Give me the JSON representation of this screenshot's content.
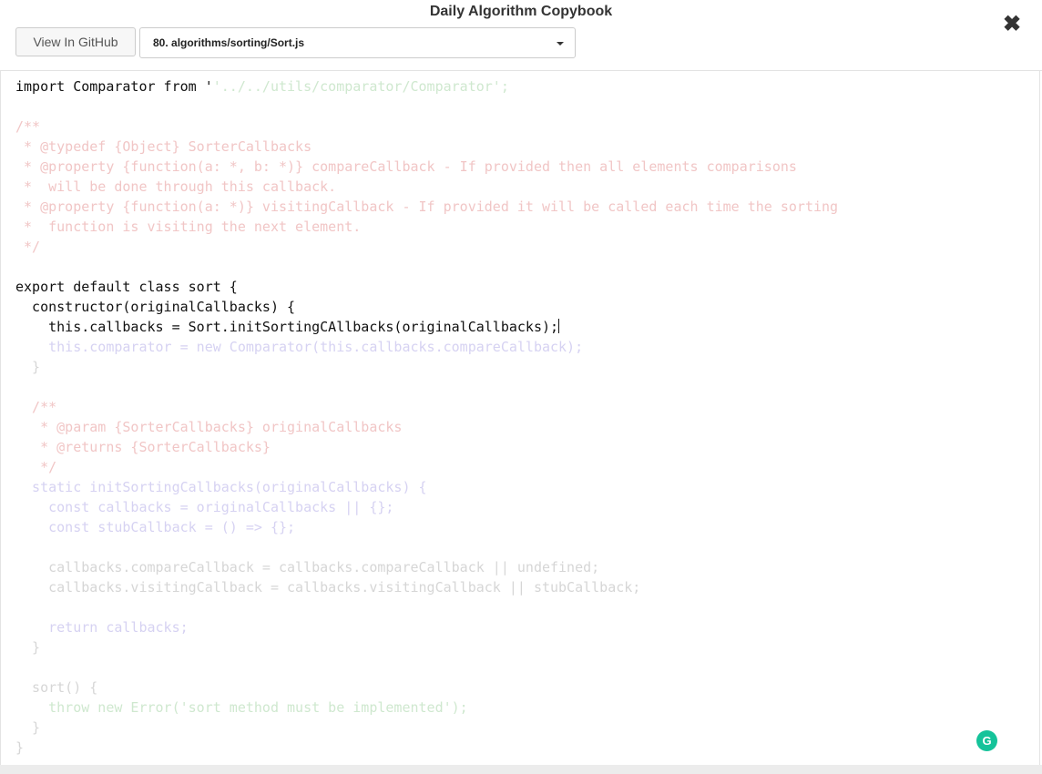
{
  "header": {
    "title": "Daily Algorithm Copybook",
    "close_icon": "✖"
  },
  "toolbar": {
    "github_label": "View In GitHub",
    "file_selected": "80. algorithms/sorting/Sort.js"
  },
  "editor": {
    "lines": [
      {
        "typed": "import Comparator from '",
        "ghost": "'../../utils/comparator/Comparator';",
        "ghost_style": "gs"
      },
      {
        "typed": "",
        "ghost": "",
        "ghost_style": "gf"
      },
      {
        "typed": "",
        "ghost": "/**",
        "ghost_style": "gc"
      },
      {
        "typed": "",
        "ghost": " * @typedef {Object} SorterCallbacks",
        "ghost_style": "gc"
      },
      {
        "typed": "",
        "ghost": " * @property {function(a: *, b: *)} compareCallback - If provided then all elements comparisons",
        "ghost_style": "gc"
      },
      {
        "typed": "",
        "ghost": " *  will be done through this callback.",
        "ghost_style": "gc"
      },
      {
        "typed": "",
        "ghost": " * @property {function(a: *)} visitingCallback - If provided it will be called each time the sorting",
        "ghost_style": "gc"
      },
      {
        "typed": "",
        "ghost": " *  function is visiting the next element.",
        "ghost_style": "gc"
      },
      {
        "typed": "",
        "ghost": " */",
        "ghost_style": "gc"
      },
      {
        "typed": "",
        "ghost": "",
        "ghost_style": "gf"
      },
      {
        "typed": "export default class sort {",
        "ghost": "",
        "ghost_style": "gf"
      },
      {
        "typed": "  constructor(originalCallbacks) {",
        "ghost": "",
        "ghost_style": "gf"
      },
      {
        "typed": "    this.callbacks = Sort.initSortingCAllbacks(originalCallbacks);",
        "ghost": "",
        "ghost_style": "gf",
        "cursor": true
      },
      {
        "typed": "",
        "ghost": "    this.comparator = new Comparator(this.callbacks.compareCallback);",
        "ghost_style": "gk"
      },
      {
        "typed": "",
        "ghost": "  }",
        "ghost_style": "gf"
      },
      {
        "typed": "",
        "ghost": "",
        "ghost_style": "gf"
      },
      {
        "typed": "",
        "ghost": "  /**",
        "ghost_style": "gc"
      },
      {
        "typed": "",
        "ghost": "   * @param {SorterCallbacks} originalCallbacks",
        "ghost_style": "gc"
      },
      {
        "typed": "",
        "ghost": "   * @returns {SorterCallbacks}",
        "ghost_style": "gc"
      },
      {
        "typed": "",
        "ghost": "   */",
        "ghost_style": "gc"
      },
      {
        "typed": "",
        "ghost": "  static initSortingCallbacks(originalCallbacks) {",
        "ghost_style": "gk"
      },
      {
        "typed": "",
        "ghost": "    const callbacks = originalCallbacks || {};",
        "ghost_style": "gk"
      },
      {
        "typed": "",
        "ghost": "    const stubCallback = () => {};",
        "ghost_style": "gk"
      },
      {
        "typed": "",
        "ghost": "",
        "ghost_style": "gf"
      },
      {
        "typed": "",
        "ghost": "    callbacks.compareCallback = callbacks.compareCallback || undefined;",
        "ghost_style": "gf"
      },
      {
        "typed": "",
        "ghost": "    callbacks.visitingCallback = callbacks.visitingCallback || stubCallback;",
        "ghost_style": "gf"
      },
      {
        "typed": "",
        "ghost": "",
        "ghost_style": "gf"
      },
      {
        "typed": "",
        "ghost": "    return callbacks;",
        "ghost_style": "gk"
      },
      {
        "typed": "",
        "ghost": "  }",
        "ghost_style": "gf"
      },
      {
        "typed": "",
        "ghost": "",
        "ghost_style": "gf"
      },
      {
        "typed": "",
        "ghost": "  sort() {",
        "ghost_style": "gf"
      },
      {
        "typed": "",
        "ghost": "    throw new Error('sort method must be implemented');",
        "ghost_style": "gs"
      },
      {
        "typed": "",
        "ghost": "  }",
        "ghost_style": "gf"
      },
      {
        "typed": "",
        "ghost": "}",
        "ghost_style": "gf"
      }
    ]
  },
  "grammarly": {
    "label": "G",
    "color": "#15c39a"
  }
}
